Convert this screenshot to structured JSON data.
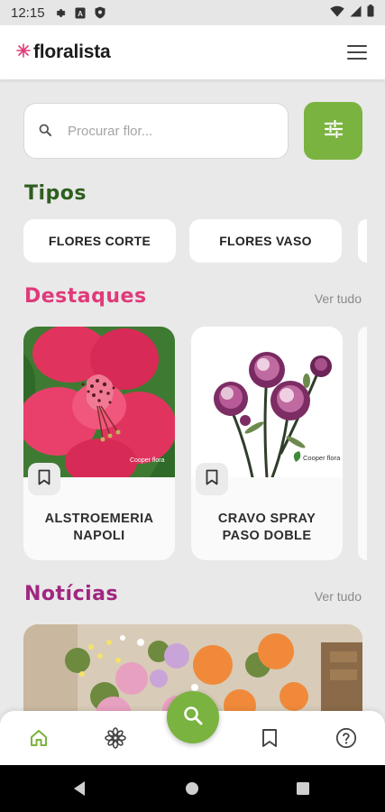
{
  "status_bar": {
    "time": "12:15"
  },
  "header": {
    "logo_text": "floralista"
  },
  "search": {
    "placeholder": "Procurar flor..."
  },
  "types": {
    "title": "Tipos",
    "items": [
      {
        "label": "FLORES CORTE"
      },
      {
        "label": "FLORES VASO"
      }
    ]
  },
  "featured": {
    "title": "Destaques",
    "see_all": "Ver tudo",
    "items": [
      {
        "name": "ALSTROEMERIA NAPOLI",
        "brand": "Cooper flora"
      },
      {
        "name": "CRAVO SPRAY PASO DOBLE",
        "brand": "Cooper flora"
      }
    ]
  },
  "news": {
    "title": "Notícias",
    "see_all": "Ver tudo"
  },
  "bottom_nav": {
    "items": [
      {
        "icon": "home-icon",
        "active": true
      },
      {
        "icon": "flower-icon",
        "active": false
      },
      {
        "icon": "search-icon",
        "active": false
      },
      {
        "icon": "bookmark-icon",
        "active": false
      },
      {
        "icon": "help-icon",
        "active": false
      }
    ]
  },
  "colors": {
    "accent_green": "#7ab340",
    "types_title": "#2e5e1f",
    "featured_title": "#e03a7a",
    "news_title": "#a02680"
  }
}
